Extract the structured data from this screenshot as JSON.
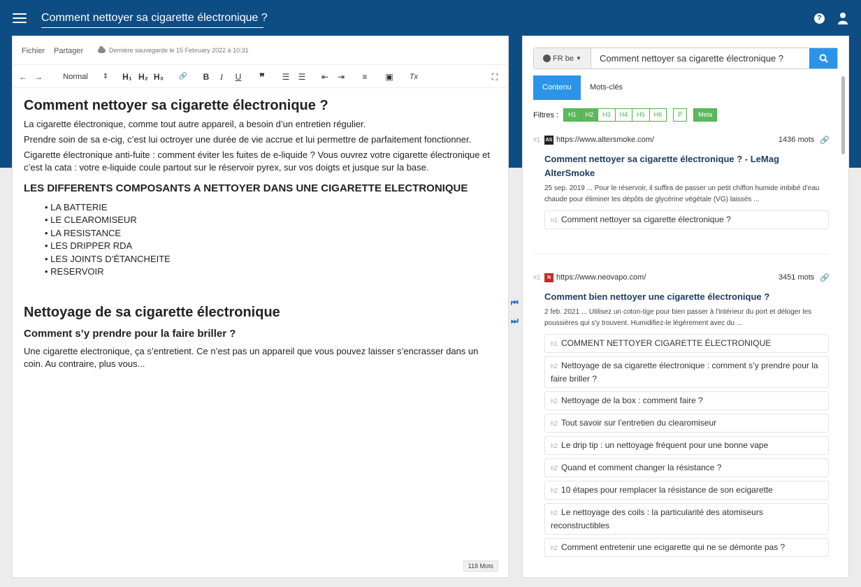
{
  "header": {
    "title": "Comment nettoyer sa cigarette électronique ?",
    "help_label": "?"
  },
  "editor": {
    "menu": {
      "file": "Fichier",
      "share": "Partager"
    },
    "save_status": "Dernière sauvegarde le 15 February 2022 à 10:31",
    "toolbar": {
      "undo": "←",
      "redo": "→",
      "style": "Normal",
      "style_arrows": "⇕",
      "h1": "H₁",
      "h2": "H₂",
      "h3": "H₃",
      "link": "🔗",
      "bold": "B",
      "italic": "I",
      "underline": "U",
      "quote": "❞",
      "ol": "☰",
      "ul": "☰",
      "outdent": "⇤",
      "indent": "⇥",
      "align": "≡",
      "image": "▣",
      "clear": "Tx",
      "fullscreen": "⛶"
    },
    "doc": {
      "h1": "Comment nettoyer sa cigarette électronique ?",
      "p1": "La cigarette électronique, comme tout autre appareil, a besoin d’un entretien régulier.",
      "p2": "Prendre soin de sa e-cig, c’est lui octroyer une durée de vie accrue et lui permettre de parfaitement fonctionner.",
      "p3": "Cigarette électronique anti-fuite : comment éviter les fuites de e-liquide ? Vous ouvrez votre cigarette électronique et c’est la cata : votre e-liquide coule partout sur le réservoir pyrex, sur vos doigts et jusque sur la base.",
      "h2": "LES DIFFERENTS COMPOSANTS A NETTOYER DANS UNE CIGARETTE ELECTRONIQUE",
      "list": [
        "LA BATTERIE",
        "LE CLEAROMISEUR",
        "LA RESISTANCE",
        "LES DRIPPER RDA",
        "LES JOINTS D’ÉTANCHEITE",
        "RESERVOIR"
      ],
      "h1b": "Nettoyage de sa cigarette électronique",
      "h3": "Comment s’y prendre pour la faire briller ?",
      "p4": "Une cigarette electronique, ça s’entretient. Ce n’est pas un appareil que vous pouvez laisser s’encrasser dans un coin. Au contraire, plus vous..."
    },
    "word_count": "118 Mots"
  },
  "panel_toggle": {
    "collapse": "⏮",
    "expand": "⏭"
  },
  "side": {
    "lang": "FR be",
    "query": "Comment nettoyer sa cigarette électronique ?",
    "tabs": [
      "Contenu",
      "Mots-clés"
    ],
    "filters_label": "Filtres :",
    "filters": [
      {
        "label": "H1",
        "on": true
      },
      {
        "label": "H2",
        "on": true
      },
      {
        "label": "H3",
        "on": false
      },
      {
        "label": "H4",
        "on": false
      },
      {
        "label": "H5",
        "on": false
      },
      {
        "label": "H6",
        "on": false
      },
      {
        "label": "P",
        "on": false
      },
      {
        "label": "Meta",
        "on": true
      }
    ],
    "results": [
      {
        "rank": "#1",
        "favicon": "AS",
        "url": "https://www.altersmoke.com/",
        "words": "1436 mots",
        "title": "Comment nettoyer sa cigarette électronique ? - LeMag AlterSmoke",
        "snippet": "25 sep. 2019 ... Pour le réservoir, il suffira de passer un petit chiffon humide imbibé d'eau chaude pour éliminer les dépôts de glycérine végétale (VG) laissés ...",
        "headings": [
          {
            "tag": "h1",
            "text": "Comment nettoyer sa cigarette électronique ?"
          }
        ]
      },
      {
        "rank": "#2",
        "favicon": "N",
        "url": "https://www.neovapo.com/",
        "words": "3451 mots",
        "title": "Comment bien nettoyer une cigarette électronique ?",
        "snippet": "2 feb. 2021 ... Utilisez un coton-tige pour bien passer à l'intérieur du port et déloger les poussières qui s'y trouvent. Humidifiez-le légèrement avec du ...",
        "headings": [
          {
            "tag": "h1",
            "text": "COMMENT NETTOYER CIGARETTE ÉLECTRONIQUE"
          },
          {
            "tag": "h2",
            "text": "Nettoyage de sa cigarette électronique : comment s’y prendre pour la faire briller ?"
          },
          {
            "tag": "h2",
            "text": "Nettoyage de la box : comment faire ?"
          },
          {
            "tag": "h2",
            "text": "Tout savoir sur l’entretien du clearomiseur"
          },
          {
            "tag": "h2",
            "text": "Le drip tip : un nettoyage fréquent pour une bonne vape"
          },
          {
            "tag": "h2",
            "text": "Quand et comment changer la résistance ?"
          },
          {
            "tag": "h2",
            "text": "10 étapes pour remplacer la résistance de son ecigarette"
          },
          {
            "tag": "h2",
            "text": "Le nettoyage des coils : la particularité des atomiseurs reconstructibles"
          },
          {
            "tag": "h2",
            "text": "Comment entretenir une ecigarette qui ne se démonte pas ?"
          }
        ]
      }
    ]
  },
  "colors": {
    "header_bg": "#0e4d84",
    "accent_blue": "#2b94e8",
    "filter_green": "#5cb85c"
  }
}
